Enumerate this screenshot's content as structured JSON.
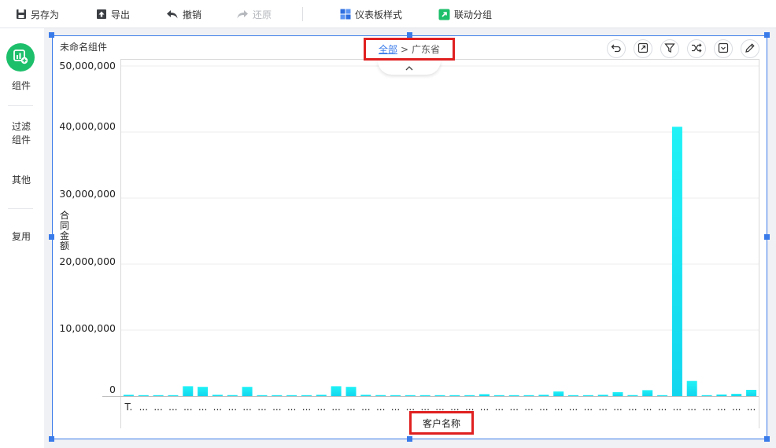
{
  "toolbar": {
    "save_as": "另存为",
    "export": "导出",
    "undo": "撤销",
    "redo": "还原",
    "dashboard_style": "仪表板样式",
    "linked_group": "联动分组"
  },
  "sidebar": {
    "component": "组件",
    "filter_component": "过滤组件",
    "other": "其他",
    "reuse": "复用"
  },
  "widget": {
    "title": "未命名组件",
    "breadcrumb_root": "全部",
    "breadcrumb_sep": ">",
    "breadcrumb_current": "广东省"
  },
  "colors": {
    "accent": "#3a7bea",
    "bar": "#1fe6f5",
    "highlight": "#e02020",
    "component_button": "#1dbf6b"
  },
  "chart_data": {
    "type": "bar",
    "xlabel": "客户名称",
    "ylabel": "合同金额",
    "ylim": [
      0,
      50000000
    ],
    "ytick_labels": [
      "50,000,000",
      "40,000,000",
      "30,000,000",
      "20,000,000",
      "10,000,000",
      "0"
    ],
    "yticks": [
      50000000,
      40000000,
      30000000,
      20000000,
      10000000,
      0
    ],
    "category_labels": [
      "T.",
      "...",
      "...",
      "...",
      "...",
      "...",
      "...",
      "...",
      "...",
      "...",
      "...",
      "...",
      "...",
      "...",
      "...",
      "...",
      "...",
      "...",
      "...",
      "...",
      "...",
      "...",
      "...",
      "...",
      "...",
      "...",
      "...",
      "...",
      "...",
      "...",
      "...",
      "...",
      "...",
      "...",
      "...",
      "...",
      "...",
      "...",
      "...",
      "...",
      "...",
      "...",
      "..."
    ],
    "values": [
      200000,
      120000,
      100000,
      120000,
      1500000,
      1400000,
      200000,
      150000,
      1400000,
      100000,
      0,
      0,
      80000,
      200000,
      1500000,
      1400000,
      200000,
      150000,
      0,
      80000,
      0,
      80000,
      120000,
      0,
      300000,
      0,
      100000,
      120000,
      200000,
      700000,
      0,
      120000,
      200000,
      600000,
      150000,
      900000,
      100000,
      40800000,
      2300000,
      0,
      250000,
      350000,
      950000
    ],
    "grid": true,
    "legend": "none"
  }
}
